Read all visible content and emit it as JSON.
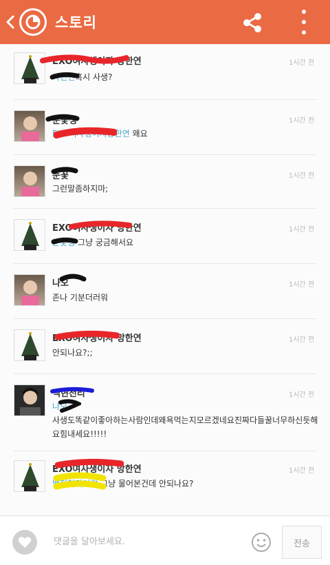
{
  "header": {
    "title": "스토리",
    "bg_color": "#ea6a43"
  },
  "comments": [
    {
      "author": "EXO여사생이자 망한연",
      "mention": "나인연",
      "text": "혹시 사생?",
      "time": "1시간 전"
    },
    {
      "author": "눈꽃생",
      "mention": "EXO여사생이자망한연",
      "text": " 왜요",
      "time": "1시간 전"
    },
    {
      "author": "눈꽃",
      "mention": "",
      "text": "그런말좀하지마;",
      "time": "1시간 전"
    },
    {
      "author": "EXO여사생이자 망한연",
      "mention": "눈꽃생",
      "text": " 그냥 궁금해서요",
      "time": "1시간 전"
    },
    {
      "author": "나오",
      "mention": "",
      "text": "존나 기분더러워",
      "time": "1시간 전"
    },
    {
      "author": "EXO여사생이자 망한연",
      "mention": "",
      "text": "안되나요?;;",
      "time": "1시간 전"
    },
    {
      "author": "백현천리",
      "mention": "나오",
      "text": "사생도똑같이좋아하는사람인데왜욕먹는지모르겠네요진짜다들꿀너무하신듯해요힘내세요!!!!!",
      "time": "1시간 전"
    },
    {
      "author": "EXO여사생이자 망한연",
      "mention": "백현천리이랑",
      "text": " 그냥 물어본건데 안되나요?",
      "time": "1시간 전"
    }
  ],
  "bottom_bar": {
    "input_placeholder": "댓글을 달아보세요.",
    "send_label": "전송"
  },
  "icons": [
    "back-icon",
    "app-logo-icon",
    "share-icon",
    "more-icon",
    "heart-icon",
    "emoji-icon"
  ]
}
